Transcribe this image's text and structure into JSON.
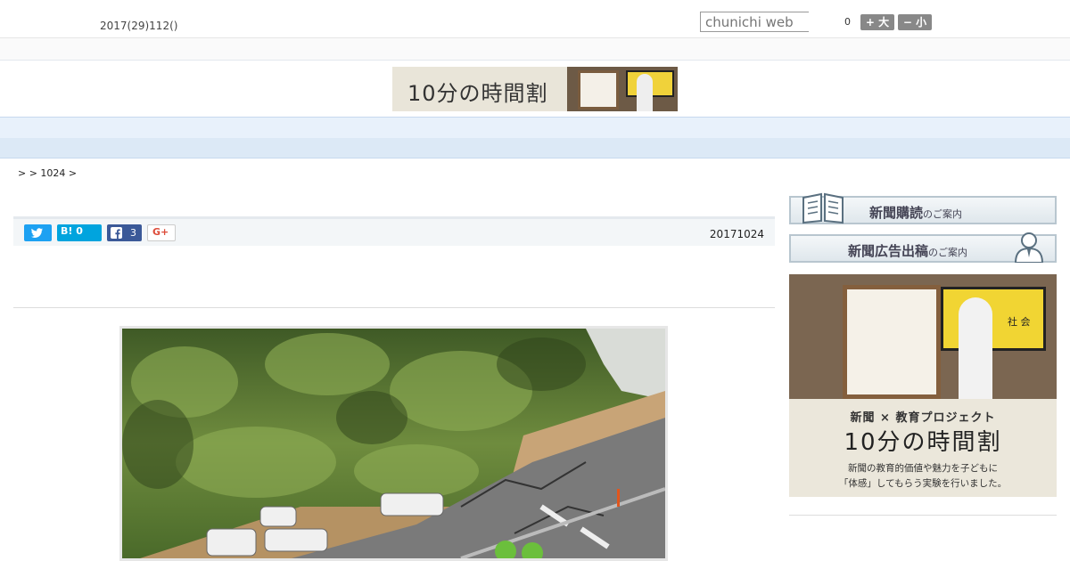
{
  "header": {
    "date": "2017(29)112()",
    "search_placeholder": "chunichi web",
    "count": "0",
    "font_bigger": "+ 大",
    "font_smaller": "− 小"
  },
  "banner": {
    "text": "10分の時間割"
  },
  "nav": {
    "items": [
      "",
      "",
      "",
      "",
      "",
      "",
      "",
      "",
      ""
    ]
  },
  "breadcrumb": ">  > 1024 >",
  "share": {
    "twitter_icon": "twitter-bird-icon",
    "hatena_label": "B! 0",
    "facebook_count": "3",
    "gplus_label": "G+"
  },
  "article": {
    "date": "20171024"
  },
  "sidebar": {
    "subscribe": {
      "main": "新聞購読",
      "small": "のご案内"
    },
    "advertise": {
      "main": "新聞広告出稿",
      "small": "のご案内"
    },
    "ad": {
      "screen_text": "社 会",
      "subtitle": "新聞 × 教育プロジェクト",
      "title": "10分の時間割",
      "body_line1": "新聞の教育的価値や魅力を子どもに",
      "body_line2": "「体感」してもらう実験を行いました。"
    }
  },
  "colors": {
    "twitter": "#1da1f2",
    "hatena": "#00a4de",
    "facebook": "#3b5998",
    "nav_bg": "#e8f1fb"
  }
}
